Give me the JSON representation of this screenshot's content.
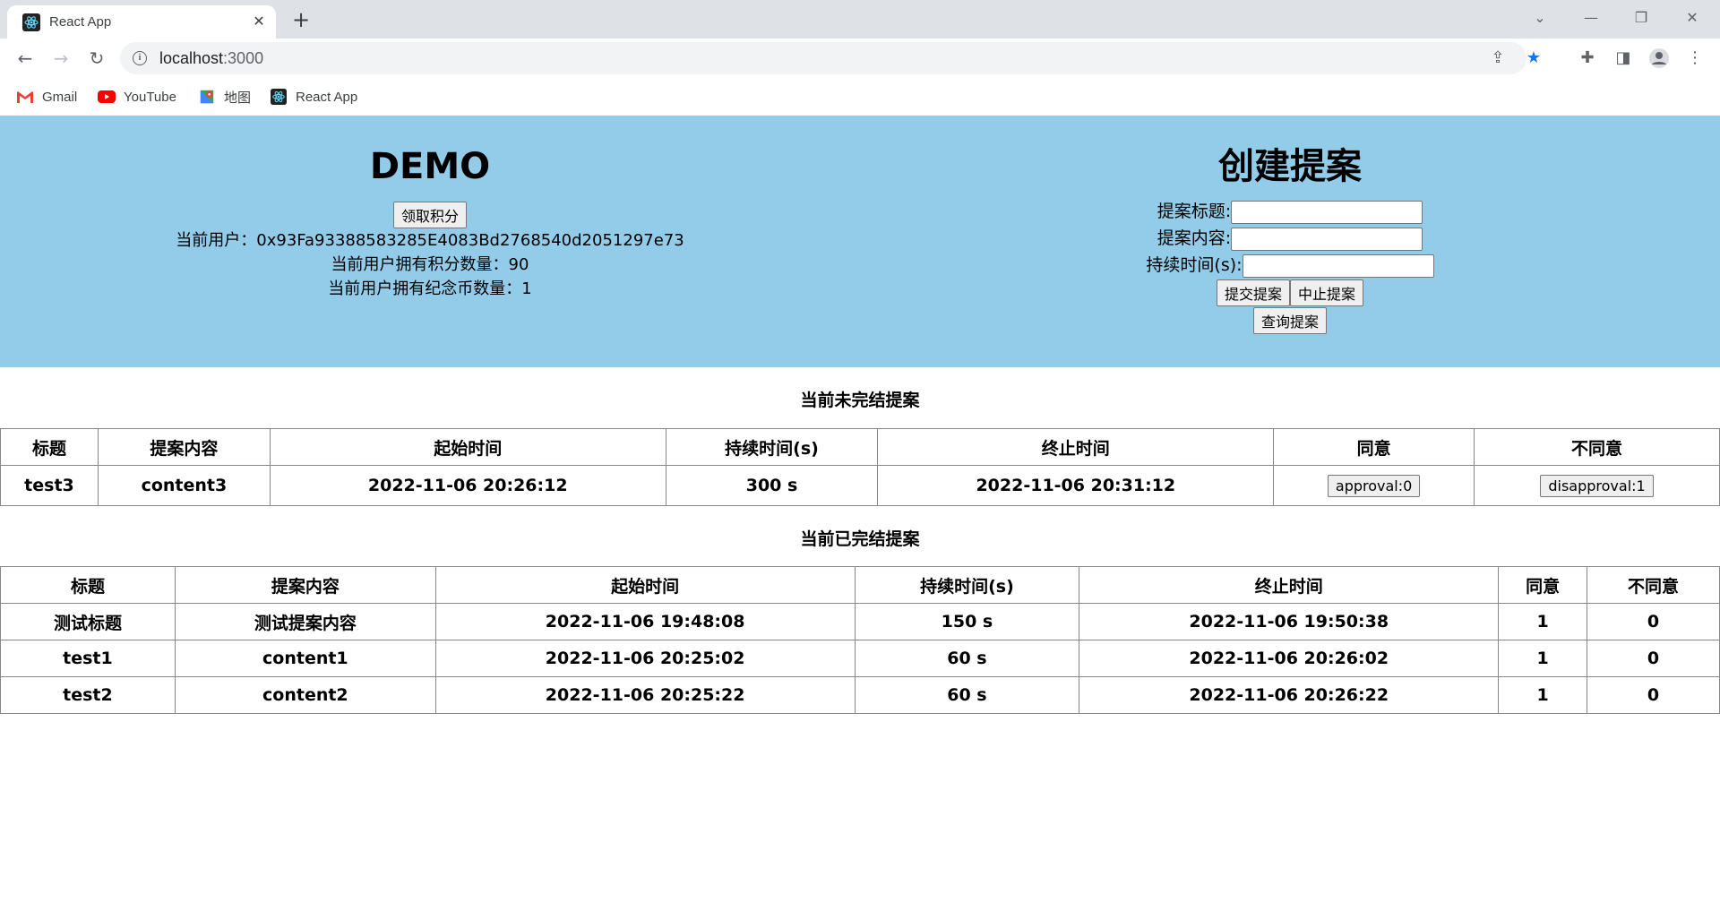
{
  "browser": {
    "tab_title": "React App",
    "url_host": "localhost",
    "url_port": ":3000",
    "bookmarks": [
      "Gmail",
      "YouTube",
      "地图",
      "React App"
    ],
    "colors": {
      "tabstrip": "#dee1e6",
      "star": "#1a73e8",
      "gmail": "#ea4335",
      "youtube": "#ff0000"
    }
  },
  "header": {
    "bg_color": "#93cce9",
    "demo_title": "DEMO",
    "claim_button": "领取积分",
    "current_user": "当前用户：0x93Fa93388583285E4083Bd2768540d2051297e73",
    "points_text": "当前用户拥有积分数量：90",
    "coins_text": "当前用户拥有纪念币数量：1",
    "create_title": "创建提案",
    "title_label": "提案标题:",
    "content_label": "提案内容:",
    "duration_label": "持续时间(s):",
    "title_value": "",
    "content_value": "",
    "duration_value": "",
    "submit_button": "提交提案",
    "stop_button": "中止提案",
    "query_button": "查询提案"
  },
  "ongoing": {
    "title": "当前未完结提案",
    "headers": [
      "标题",
      "提案内容",
      "起始时间",
      "持续时间(s)",
      "终止时间",
      "同意",
      "不同意"
    ],
    "rows": [
      {
        "title": "test3",
        "content": "content3",
        "start": "2022-11-06 20:26:12",
        "duration": "300 s",
        "end": "2022-11-06 20:31:12",
        "approve": "approval:0",
        "disapprove": "disapproval:1"
      }
    ]
  },
  "finished": {
    "title": "当前已完结提案",
    "headers": [
      "标题",
      "提案内容",
      "起始时间",
      "持续时间(s)",
      "终止时间",
      "同意",
      "不同意"
    ],
    "rows": [
      {
        "title": "测试标题",
        "content": "测试提案内容",
        "start": "2022-11-06 19:48:08",
        "duration": "150 s",
        "end": "2022-11-06 19:50:38",
        "approve": "1",
        "disapprove": "0"
      },
      {
        "title": "test1",
        "content": "content1",
        "start": "2022-11-06 20:25:02",
        "duration": "60 s",
        "end": "2022-11-06 20:26:02",
        "approve": "1",
        "disapprove": "0"
      },
      {
        "title": "test2",
        "content": "content2",
        "start": "2022-11-06 20:25:22",
        "duration": "60 s",
        "end": "2022-11-06 20:26:22",
        "approve": "1",
        "disapprove": "0"
      }
    ]
  }
}
